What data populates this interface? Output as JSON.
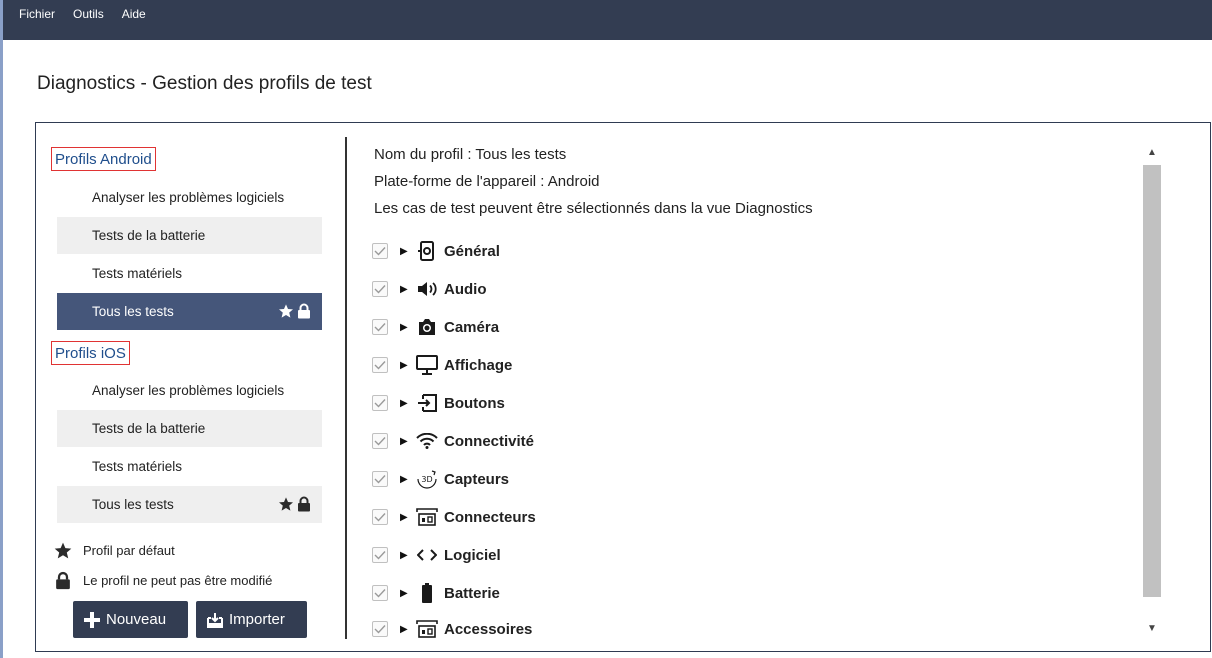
{
  "menu": {
    "file": "Fichier",
    "tools": "Outils",
    "help": "Aide"
  },
  "page_title": "Diagnostics - Gestion des profils de test",
  "android": {
    "header": "Profils Android",
    "items": [
      "Analyser les problèmes logiciels",
      "Tests de la batterie",
      "Tests matériels",
      "Tous les tests"
    ]
  },
  "ios": {
    "header": "Profils iOS",
    "items": [
      "Analyser les problèmes logiciels",
      "Tests de la batterie",
      "Tests matériels",
      "Tous les tests"
    ]
  },
  "legend": {
    "default": "Profil par défaut",
    "locked": "Le profil ne peut pas être modifié"
  },
  "buttons": {
    "new": "Nouveau",
    "import": "Importer"
  },
  "profile_info": {
    "name": "Nom du profil : Tous les tests",
    "platform": "Plate-forme de l'appareil : Android",
    "note": "Les cas de test peuvent être sélectionnés dans la vue Diagnostics"
  },
  "categories": [
    {
      "label": "Général",
      "icon": "general-icon",
      "checked": true
    },
    {
      "label": "Audio",
      "icon": "speaker-icon",
      "checked": true
    },
    {
      "label": "Caméra",
      "icon": "camera-icon",
      "checked": true
    },
    {
      "label": "Affichage",
      "icon": "monitor-icon",
      "checked": true
    },
    {
      "label": "Boutons",
      "icon": "buttons-icon",
      "checked": true
    },
    {
      "label": "Connectivité",
      "icon": "wifi-icon",
      "checked": true
    },
    {
      "label": "Capteurs",
      "icon": "sensor-3d-icon",
      "checked": true
    },
    {
      "label": "Connecteurs",
      "icon": "connector-icon",
      "checked": true
    },
    {
      "label": "Logiciel",
      "icon": "code-icon",
      "checked": true
    },
    {
      "label": "Batterie",
      "icon": "battery-icon",
      "checked": true
    },
    {
      "label": "Accessoires",
      "icon": "connector-icon",
      "checked": true
    }
  ],
  "colors": {
    "menubar": "#333d52",
    "selected": "#45567a",
    "highlight_border": "#e03333"
  }
}
